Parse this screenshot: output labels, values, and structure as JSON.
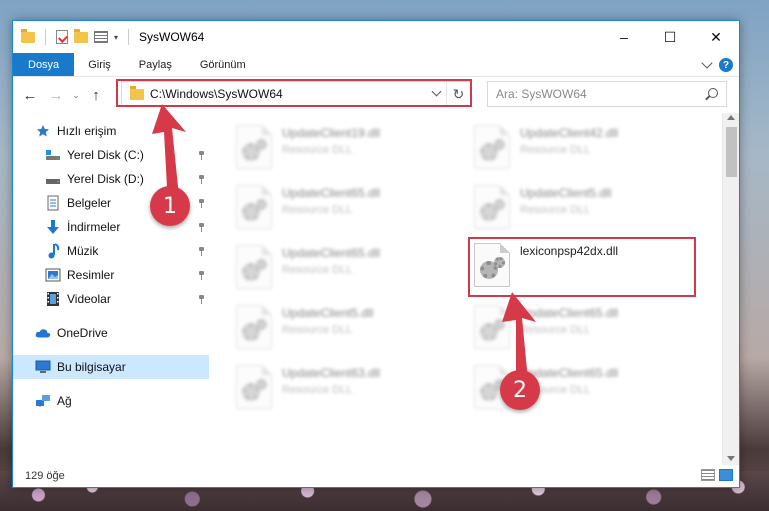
{
  "window": {
    "title": "SysWOW64",
    "controls": {
      "minimize": "–",
      "maximize": "☐",
      "close": "✕"
    }
  },
  "ribbon": {
    "tabs": [
      {
        "label": "Dosya",
        "active": true
      },
      {
        "label": "Giriş"
      },
      {
        "label": "Paylaş"
      },
      {
        "label": "Görünüm"
      }
    ],
    "help": "?"
  },
  "nav": {
    "back": "←",
    "forward": "→",
    "recent": "⌄",
    "up": "↑"
  },
  "address": {
    "path": "C:\\Windows\\SysWOW64",
    "refresh": "↻"
  },
  "search": {
    "placeholder": "Ara: SysWOW64"
  },
  "sidebar": {
    "items": [
      {
        "label": "Hızlı erişim",
        "icon": "star-icon"
      },
      {
        "label": "Yerel Disk (C:)",
        "icon": "drive-icon",
        "pinned": true
      },
      {
        "label": "Yerel Disk (D:)",
        "icon": "drive-icon",
        "pinned": true
      },
      {
        "label": "Belgeler",
        "icon": "documents-icon",
        "pinned": true
      },
      {
        "label": "İndirmeler",
        "icon": "download-icon",
        "pinned": true
      },
      {
        "label": "Müzik",
        "icon": "music-icon",
        "pinned": true
      },
      {
        "label": "Resimler",
        "icon": "pictures-icon",
        "pinned": true
      },
      {
        "label": "Videolar",
        "icon": "videos-icon",
        "pinned": true
      },
      {
        "label": "OneDrive",
        "icon": "cloud-icon"
      },
      {
        "label": "Bu bilgisayar",
        "icon": "computer-icon",
        "selected": true
      },
      {
        "label": "Ağ",
        "icon": "network-icon"
      }
    ]
  },
  "files": [
    {
      "name": "UpdateClient19.dll",
      "desc": "Resource DLL",
      "blurred": true
    },
    {
      "name": "UpdateClient42.dll",
      "desc": "Resource DLL",
      "blurred": true
    },
    {
      "name": "UpdateClient65.dll",
      "desc": "Resource DLL",
      "blurred": true
    },
    {
      "name": "UpdateClient5.dll",
      "desc": "Resource DLL",
      "blurred": true
    },
    {
      "name": "UpdateClient65.dll",
      "desc": "Resource DLL",
      "blurred": true
    },
    {
      "name": "lexiconpsp42dx.dll",
      "desc": "",
      "blurred": false
    },
    {
      "name": "UpdateClient5.dll",
      "desc": "Resource DLL",
      "blurred": true
    },
    {
      "name": "UpdateClient65.dll",
      "desc": "Resource DLL",
      "blurred": true
    },
    {
      "name": "UpdateClient63.dll",
      "desc": "Resource DLL",
      "blurred": true
    },
    {
      "name": "UpdateClient65.dll",
      "desc": "Resource DLL",
      "blurred": true
    }
  ],
  "status": {
    "count": "129 öğe"
  },
  "annotations": {
    "step1": "1",
    "step2": "2",
    "highlight_color": "#d0394a"
  },
  "colors": {
    "accent": "#1979ca",
    "selected_bg": "#cce8ff"
  }
}
